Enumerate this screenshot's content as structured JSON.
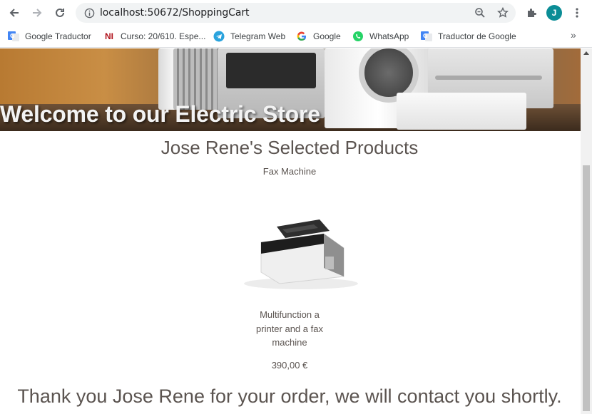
{
  "browser": {
    "url": "localhost:50672/ShoppingCart",
    "avatar_letter": "J",
    "bookmarks": [
      {
        "label": "Google Traductor",
        "icon": "google-translate-icon"
      },
      {
        "label": "Curso: 20/610. Espe...",
        "icon": "ni-icon"
      },
      {
        "label": "Telegram Web",
        "icon": "telegram-icon"
      },
      {
        "label": "Google",
        "icon": "google-icon"
      },
      {
        "label": "WhatsApp",
        "icon": "whatsapp-icon"
      },
      {
        "label": "Traductor de Google",
        "icon": "google-translate-icon"
      }
    ],
    "more_bookmarks": "»"
  },
  "page": {
    "hero_title": "Welcome to our Electric Store",
    "section_title": "Jose Rene's Selected Products",
    "product": {
      "name": "Fax Machine",
      "description": "Multifunction a printer and a fax machine",
      "price": "390,00 €"
    },
    "thanks_message": "Thank you Jose Rene for your order, we will contact you shortly."
  },
  "colors": {
    "text": "#5b5450",
    "avatar": "#0b8d96"
  }
}
